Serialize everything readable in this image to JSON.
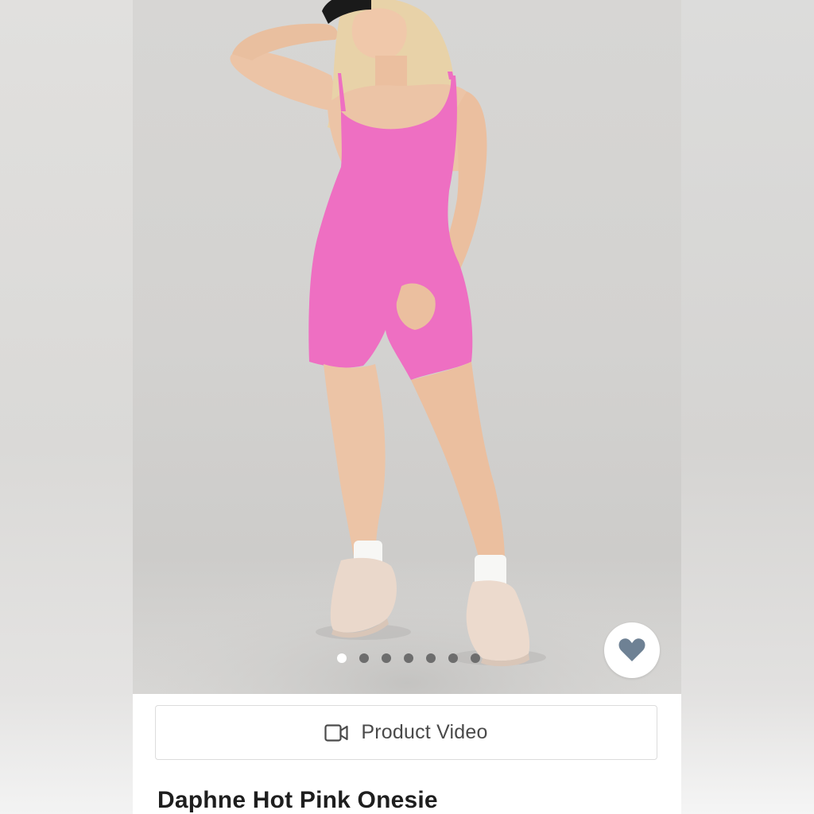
{
  "product": {
    "title": "Daphne Hot Pink Onesie",
    "video_button_label": "Product Video",
    "video_icon": "video-camera-icon",
    "favorite_icon": "heart-icon"
  },
  "gallery": {
    "image_count": 7,
    "active_index": 0
  },
  "colors": {
    "product_color": "#ee6fc2",
    "heart_color": "#6e8194",
    "active_dot": "#ffffff",
    "inactive_dot": "#6d6d6d"
  }
}
